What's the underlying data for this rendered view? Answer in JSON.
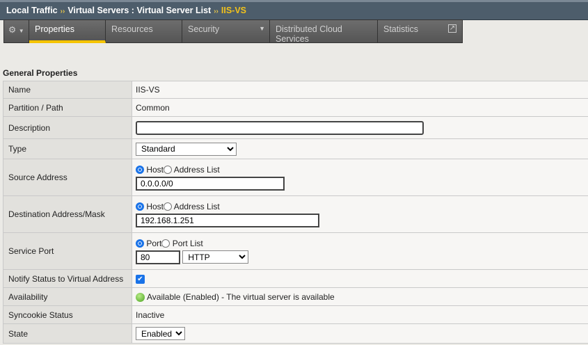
{
  "breadcrumb": {
    "items": [
      "Local Traffic",
      "Virtual Servers : Virtual Server List"
    ],
    "current": "IIS-VS",
    "separator": "››"
  },
  "tabs": [
    {
      "label": "Properties"
    },
    {
      "label": "Resources"
    },
    {
      "label": "Security"
    },
    {
      "label": "Distributed Cloud Services"
    },
    {
      "label": "Statistics"
    }
  ],
  "section_title": "General Properties",
  "fields": {
    "name": {
      "label": "Name",
      "value": "IIS-VS"
    },
    "partition": {
      "label": "Partition / Path",
      "value": "Common"
    },
    "description": {
      "label": "Description",
      "value": ""
    },
    "type": {
      "label": "Type",
      "value": "Standard"
    },
    "source": {
      "label": "Source Address",
      "opt1": "Host",
      "opt2": "Address List",
      "value": "0.0.0.0/0"
    },
    "destination": {
      "label": "Destination Address/Mask",
      "opt1": "Host",
      "opt2": "Address List",
      "value": "192.168.1.251"
    },
    "port": {
      "label": "Service Port",
      "opt1": "Port",
      "opt2": "Port List",
      "value": "80",
      "protocol": "HTTP"
    },
    "notify": {
      "label": "Notify Status to Virtual Address",
      "checked": true
    },
    "availability": {
      "label": "Availability",
      "value": "Available (Enabled) - The virtual server is available"
    },
    "syncookie": {
      "label": "Syncookie Status",
      "value": "Inactive"
    },
    "state": {
      "label": "State",
      "value": "Enabled"
    }
  }
}
